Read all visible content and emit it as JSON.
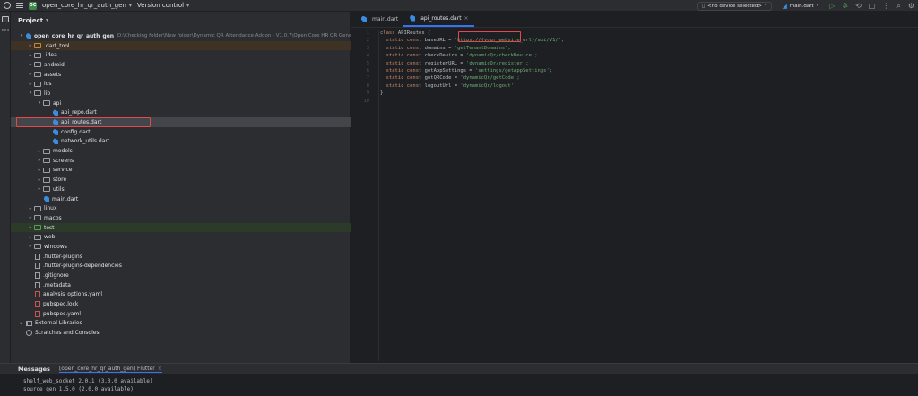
{
  "titlebar": {
    "project_badge": "OC",
    "project_name": "open_core_hr_qr_auth_gen",
    "version_control": "Version control",
    "device_select": "<no device selected>",
    "run_config": "main.dart"
  },
  "project_panel": {
    "title": "Project",
    "tree": [
      {
        "label": "open_core_hr_qr_auth_gen",
        "path": "D:\\Checking folder\\New folder\\Dynamic QR Attendance Addon - V1.0.7\\Open Core HR QR Generator",
        "depth": 0,
        "kind": "root",
        "expanded": true
      },
      {
        "label": ".dart_tool",
        "depth": 1,
        "kind": "folder-orange",
        "expanded": false,
        "style": "excluded"
      },
      {
        "label": ".idea",
        "depth": 1,
        "kind": "folder",
        "expanded": false
      },
      {
        "label": "android",
        "depth": 1,
        "kind": "folder",
        "expanded": false
      },
      {
        "label": "assets",
        "depth": 1,
        "kind": "folder",
        "expanded": false
      },
      {
        "label": "ios",
        "depth": 1,
        "kind": "folder",
        "expanded": false
      },
      {
        "label": "lib",
        "depth": 1,
        "kind": "folder",
        "expanded": true
      },
      {
        "label": "api",
        "depth": 2,
        "kind": "folder",
        "expanded": true
      },
      {
        "label": "api_repo.dart",
        "depth": 3,
        "kind": "dart"
      },
      {
        "label": "api_routes.dart",
        "depth": 3,
        "kind": "dart",
        "style": "selected"
      },
      {
        "label": "config.dart",
        "depth": 3,
        "kind": "dart"
      },
      {
        "label": "network_utils.dart",
        "depth": 3,
        "kind": "dart"
      },
      {
        "label": "models",
        "depth": 2,
        "kind": "folder",
        "expanded": false
      },
      {
        "label": "screens",
        "depth": 2,
        "kind": "folder",
        "expanded": false
      },
      {
        "label": "service",
        "depth": 2,
        "kind": "folder",
        "expanded": false
      },
      {
        "label": "store",
        "depth": 2,
        "kind": "folder",
        "expanded": false
      },
      {
        "label": "utils",
        "depth": 2,
        "kind": "folder",
        "expanded": false
      },
      {
        "label": "main.dart",
        "depth": 2,
        "kind": "dart"
      },
      {
        "label": "linux",
        "depth": 1,
        "kind": "folder",
        "expanded": false
      },
      {
        "label": "macos",
        "depth": 1,
        "kind": "folder",
        "expanded": false
      },
      {
        "label": "test",
        "depth": 1,
        "kind": "folder-green",
        "expanded": false,
        "style": "test"
      },
      {
        "label": "web",
        "depth": 1,
        "kind": "folder",
        "expanded": false
      },
      {
        "label": "windows",
        "depth": 1,
        "kind": "folder",
        "expanded": false
      },
      {
        "label": ".flutter-plugins",
        "depth": 1,
        "kind": "gen"
      },
      {
        "label": ".flutter-plugins-dependencies",
        "depth": 1,
        "kind": "gen"
      },
      {
        "label": ".gitignore",
        "depth": 1,
        "kind": "gen"
      },
      {
        "label": ".metadata",
        "depth": 1,
        "kind": "gen"
      },
      {
        "label": "analysis_options.yaml",
        "depth": 1,
        "kind": "yaml"
      },
      {
        "label": "pubspec.lock",
        "depth": 1,
        "kind": "yaml"
      },
      {
        "label": "pubspec.yaml",
        "depth": 1,
        "kind": "yaml"
      },
      {
        "label": "External Libraries",
        "depth": 0,
        "kind": "lib",
        "expanded": false
      },
      {
        "label": "Scratches and Consoles",
        "depth": 0,
        "kind": "scratch"
      }
    ]
  },
  "editor": {
    "tabs": [
      {
        "label": "main.dart",
        "active": false
      },
      {
        "label": "api_routes.dart",
        "active": true
      }
    ],
    "line_numbers": [
      "1",
      "2",
      "3",
      "4",
      "5",
      "6",
      "7",
      "8",
      "9",
      "10"
    ],
    "code": [
      {
        "kw": "class ",
        "name": "APIRoutes {",
        "str": ""
      },
      {
        "kw": "  static const ",
        "name": "baseURL = ",
        "str": "'https://{your_website_url}/api/V1/';"
      },
      {
        "kw": "  static const ",
        "name": "domains = ",
        "str": "'getTenantDomains';"
      },
      {
        "kw": "  static const ",
        "name": "checkDevice = ",
        "str": "'dynamicQr/checkDevice';"
      },
      {
        "kw": "  static const ",
        "name": "registerURL = ",
        "str": "'dynamicQr/register';"
      },
      {
        "kw": "  static const ",
        "name": "getAppSettings = ",
        "str": "'settings/getAppSettings';"
      },
      {
        "kw": "  static const ",
        "name": "getQRCode = ",
        "str": "'dynamicQr/getCode';"
      },
      {
        "kw": "  static const ",
        "name": "logoutUrl = ",
        "str": "'dynamicQr/logout';"
      },
      {
        "kw": "",
        "name": "}",
        "str": ""
      },
      {
        "kw": "",
        "name": "",
        "str": ""
      }
    ]
  },
  "messages": {
    "title": "Messages",
    "tab_label": "[open_core_hr_qr_auth_gen] Flutter",
    "lines": [
      "shelf_web_socket 2.0.1 (3.0.0 available)",
      "source_gen 1.5.0 (2.0.0 available)"
    ]
  },
  "colors": {
    "accent": "#3574f0",
    "highlight_border": "#e24a4a",
    "keyword": "#cf8e6d",
    "string": "#6aab73"
  }
}
